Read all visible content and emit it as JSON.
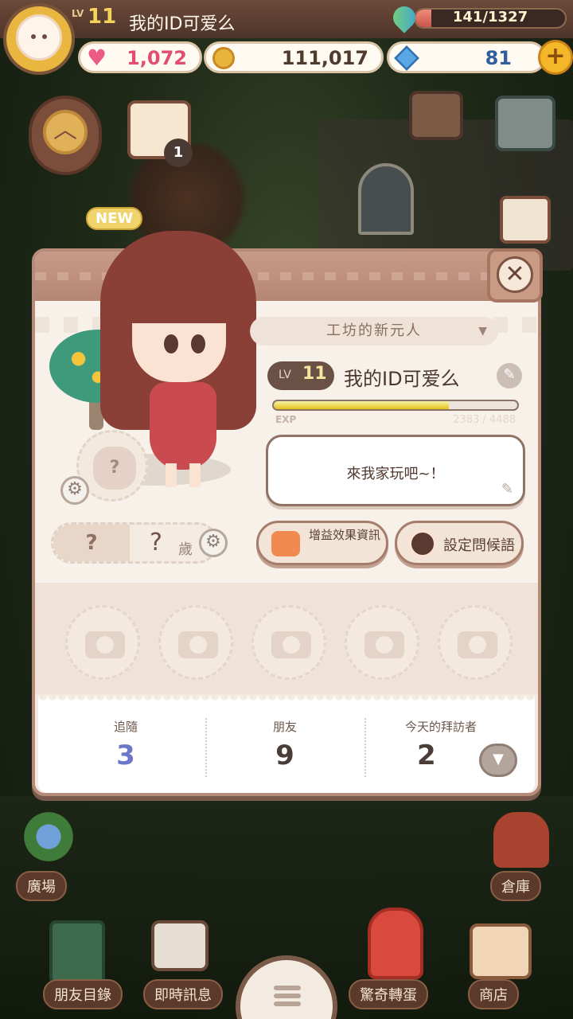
{
  "player": {
    "level_prefix": "LV",
    "level": "11",
    "name": "我的ID可爱么"
  },
  "resources": {
    "energy_text": "141/1327",
    "energy_ratio": 0.106,
    "hearts": "1,072",
    "coins": "111,017",
    "gems": "81",
    "add_label": "+"
  },
  "hud": {
    "calendar_badge": "1",
    "new_badge": "NEW"
  },
  "profile": {
    "close_label": "✕",
    "title": "工坊的新元人",
    "level_label": "LV",
    "level": "11",
    "name": "我的ID可爱么",
    "exp_label": "EXP",
    "exp_text": "2383 / 4488",
    "exp_ratio": 0.72,
    "greeting": "來我家玩吧~！",
    "pet_placeholder": "?",
    "gender_placeholder": "?",
    "age_value": "?",
    "age_suffix": "歲",
    "buff_button": "增益效果資訊",
    "greet_button": "設定問候語",
    "photo_slots": [
      "",
      "",
      "",
      "",
      ""
    ]
  },
  "stats": {
    "follow_label": "追隨",
    "follow_value": "3",
    "friends_label": "朋友",
    "friends_value": "9",
    "visitors_label": "今天的拜訪者",
    "visitors_value": "2"
  },
  "nav": {
    "plaza": "廣場",
    "storage": "倉庫",
    "friends": "朋友目錄",
    "chat": "即時訊息",
    "gacha": "驚奇轉蛋",
    "shop": "商店"
  },
  "colors": {
    "accent_gold": "#f3d35b",
    "heart": "#e04f72",
    "follow_blue": "#6b78c7"
  },
  "icons": {
    "heart": "heart-icon",
    "coin": "coin-icon",
    "gem": "gem-icon",
    "energy": "leaf-drop-icon",
    "camera": "camera-icon",
    "gear": "gear-icon",
    "edit": "pencil-icon",
    "close": "close-icon",
    "menu": "hamburger-icon"
  }
}
